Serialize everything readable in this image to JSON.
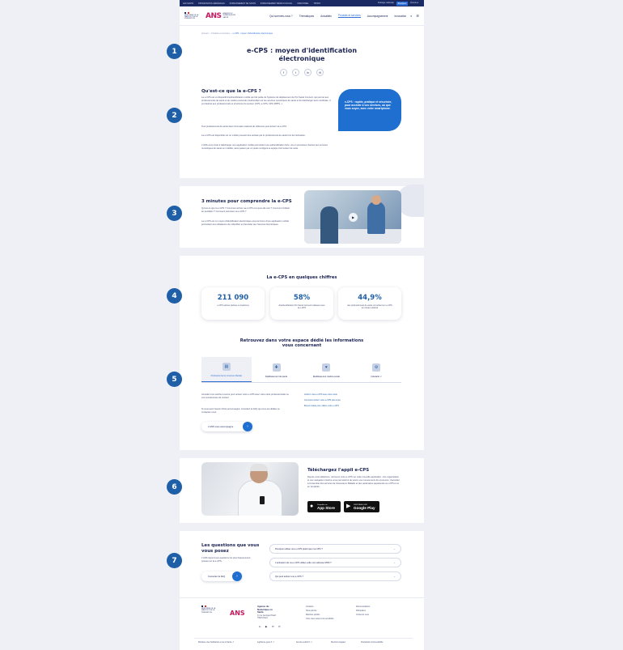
{
  "topbar": {
    "links": [
      "LES SANTÉ",
      "PROFESSIONS GÉNÉRALES",
      "ÉTABLISSEMENT DE SANTÉ",
      "ÉTABLISSEMENT MÉDICO-SOCIAL",
      "INDUSTRIEL",
      "TIPIPAY"
    ],
    "right": [
      "Stratégie nationale",
      "Rejoignez",
      "Écoute-à"
    ]
  },
  "header": {
    "logo_fr_text": "MINISTÈRE DE LA SANTÉ ET DE LA PRÉVENTION",
    "logo_ans_text": "AGENCE DU NUMÉRIQUE EN SANTÉ",
    "nav": [
      "Qui sommes-nous ?",
      "Thématiques",
      "Actualités",
      "Produits et services",
      "Accompagnement",
      "Innovation"
    ]
  },
  "breadcrumb": [
    "Accueil",
    "Produits et services",
    "e-CPS : moyen d'identification électronique"
  ],
  "title_line1": "e-CPS : moyen d'identification",
  "title_line2": "électronique",
  "share": [
    "f",
    "t",
    "in",
    "✉"
  ],
  "steps": [
    "1",
    "2",
    "3",
    "4",
    "5",
    "6",
    "7"
  ],
  "intro": {
    "heading": "Qu'est-ce que la e-CPS ?",
    "p1": "La e-CPS est un dispositif d'authentification mobile qui fait partie du Système de déploiement de Pro Santé Connect, qui permet aux professionnels de santé et du médico-social de s'authentifier sur les services numériques de santé et de télécharger leurs certificats. Il est destiné aux professionnels et structures du secteur (CPS, e-CPS, CPF, RPPS...).",
    "p2": "Tout professionnel de santé dans l'Annuaire national de référence peut activer sa e-CPS.",
    "p3": "La e-CPS est disponible sur un mobile pouvant être activée par le professionnel de santé lors de l'activation.",
    "p4": "L'ANS vous invite à télécharger une application mobile permettant une authentification forte, via un processus d'accès aux services numériques de santé en mobilité, sans passer par un poste configuré et équipé d'un lecteur de carte.",
    "callout": "e-CPS : rapide, pratique et sécurisée, pour accéder à vos services, où que vous soyez, avec votre smartphone."
  },
  "video_section": {
    "heading": "3 minutes pour comprendre la e-CPS",
    "p1": "Qu'est-ce que la e-CPS ? Comment activer sa e-CPS et à quoi elle sert ? Comment l'utiliser au quotidien ? Comment sécuriser sa e-CPS ?",
    "p2": "La e-CPS est un moyen d'identification électronique sous la forme d'une application mobile permettant aux utilisateurs de s'identifier et d'accéder aux Services Numériques.",
    "play_icon": "▶"
  },
  "stats_section": {
    "heading": "La e-CPS en quelques chiffres",
    "stats": [
      {
        "value": "211 090",
        "label": "e-CPS actives (actives et inactives)"
      },
      {
        "value": "58%",
        "label": "d'authentification Pro Santé Connect réalisées avec la e-CPS"
      },
      {
        "value": "44,9%",
        "label": "des professionnels de santé ont activé leur e-CPS au niveau national"
      }
    ]
  },
  "spaces_section": {
    "heading_line1": "Retrouvez dans votre espace dédié les informations",
    "heading_line2": "vous concernant",
    "tabs": [
      {
        "label": "Professionnel et structure libérale",
        "icon": "▤"
      },
      {
        "label": "Établissement de santé",
        "icon": "✚"
      },
      {
        "label": "Établissement médico-social",
        "icon": "♥"
      },
      {
        "label": "Industriel ↗",
        "icon": "⚙"
      }
    ],
    "left_text1": "Accédez à la marche à suivre pour activer votre e-CPS avec votre carte professionnelle ou vos coordonnées de contact.",
    "left_text2": "Si vous avez besoin d'être accompagné, consultez la FAQ qui vous est dédiée ou contactez-nous.",
    "right_links": [
      "Activez votre e-CPS avec votre carte",
      "Comment activer votre e-CPS pas à pas",
      "Besoin d'aide pour utiliser votre e-CPS"
    ],
    "cta": "L'ANS vous accompagne"
  },
  "app_section": {
    "heading": "Téléchargez l'appli e-CPS",
    "text": "Depuis votre téléphone, retrouvez votre e-CPS sur cette nouvelle application. Une organisation et une navigation intuitive vous permettront de suivre vos mouvements de connexion, d'accéder à l'ensemble des services de l'Assurance Maladie et des partenaires apparentés à e-CPS et ce en simplicité.",
    "appstore_small": "Disponible sur",
    "appstore_big": "App Store",
    "googleplay_small": "DISPONIBLE SUR",
    "googleplay_big": "Google Play"
  },
  "faq_section": {
    "heading_line1": "Les questions que vous",
    "heading_line2": "vous posez",
    "text": "L'ANS répond aux questions les plus fréquemment posées sur la e-CPS.",
    "cta": "Consulter la FAQ",
    "questions": [
      "Pourquoi utiliser une e-CPS plutôt que ma CPS ?",
      "L'activation de ma e-CPS utilise-t-elle mon adresse MSS ?",
      "Qui peut activer une e-CPS ?"
    ]
  },
  "footer": {
    "org_name": "Agence du Numérique en Santé",
    "org_address": "9, rue Georges Pitard\n75015 Paris",
    "col1": [
      "Contacts",
      "Nous joindre",
      "Marchés publics",
      "Vous nous suivez à la sensibilité"
    ],
    "col2": [
      "Documentations",
      "Webinaires",
      "Contenus vous"
    ],
    "social": [
      "in",
      "▶",
      "✉",
      "✆"
    ],
    "bottom_links": [
      "Ministère des Solidarités et de la Santé ↗",
      "legifrance.gouv.fr ↗",
      "Service-public.fr ↗",
      "Mentions légales",
      "Déclaration d'accessibilité"
    ]
  }
}
